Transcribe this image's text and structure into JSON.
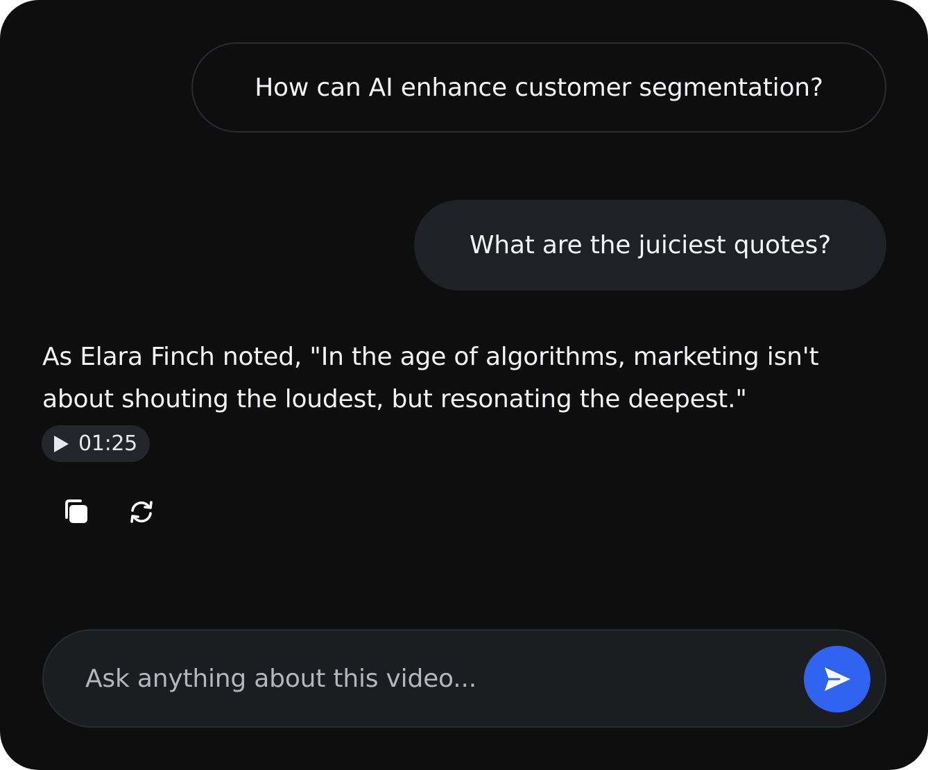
{
  "conversation": {
    "user_messages": [
      "How can AI enhance customer segmentation?",
      "What are the juiciest quotes?"
    ],
    "assistant_answer": "As Elara Finch noted, \"In the age of algorithms, marketing isn't about shouting the loudest, but resonating the deepest.\"",
    "timestamp": "01:25"
  },
  "actions": {
    "copy_icon": "copy-icon",
    "regenerate_icon": "regenerate-icon",
    "play_icon": "play-icon"
  },
  "composer": {
    "placeholder": "Ask anything about this video...",
    "send_icon": "send-icon"
  },
  "colors": {
    "background": "#0e0e0f",
    "bubble": "#202126",
    "accent": "#2f63f0"
  }
}
